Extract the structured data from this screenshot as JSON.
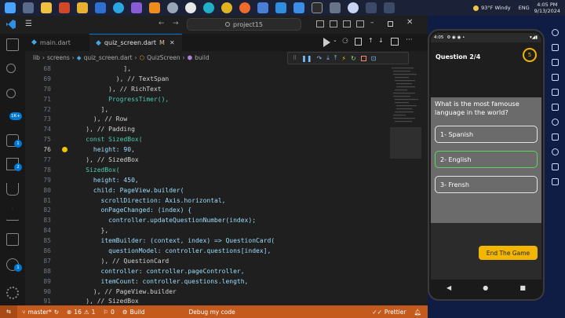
{
  "taskbar": {
    "weather": "93°F  Windy",
    "language": "ENG",
    "time": "4:05 PM",
    "date": "9/13/2024"
  },
  "vscode": {
    "search_placeholder": "project15",
    "tabs": [
      {
        "label": "main.dart",
        "modified": ""
      },
      {
        "label": "quiz_screen.dart",
        "modified": "M"
      }
    ],
    "breadcrumb": [
      "lib",
      "screens",
      "quiz_screen.dart",
      "QuizScreen",
      "build"
    ],
    "line_numbers": [
      "68",
      "69",
      "70",
      "71",
      "72",
      "73",
      "74",
      "75",
      "76",
      "77",
      "78",
      "79",
      "80",
      "81",
      "82",
      "83",
      "84",
      "85",
      "86",
      "87",
      "88",
      "89",
      "90",
      "91",
      "92"
    ],
    "current_line": "76",
    "code_lines": [
      "              ],",
      "            ), // TextSpan",
      "          ), // RichText",
      "          ProgressTimer(),",
      "        ],",
      "      ), // Row",
      "    ), // Padding",
      "    const SizedBox(",
      "      height: 90,",
      "    ), // SizedBox",
      "    SizedBox(",
      "      height: 450,",
      "      child: PageView.builder(",
      "        scrollDirection: Axis.horizontal,",
      "        onPageChanged: (index) {",
      "          controller.updateQuestionNumber(index);",
      "        },",
      "        itemBuilder: (context, index) => QuestionCard(",
      "          questionModel: controller.questions[index],",
      "        ), // QuestionCard",
      "        controller: controller.pageController,",
      "        itemCount: controller.questions.length,",
      "      ), // PageView.builder",
      "    ), // SizedBox",
      "  ]"
    ],
    "status": {
      "branch": "master*",
      "errors": "16",
      "warnings": "1",
      "ports": "0",
      "build": "Build",
      "debug": "Debug my code",
      "prettier": "Prettier"
    },
    "badges": {
      "source_control": "1K+",
      "run": "1",
      "extensions": "2",
      "accounts": "1"
    }
  },
  "phone": {
    "status_time": "4:05",
    "question_label": "Question 2/4",
    "timer_value": "5",
    "question_text": "What is the most famouse language in the world?",
    "options": [
      "1- Spanish",
      "2- English",
      "3- Frensh"
    ],
    "selected_option": "2- English",
    "end_button": "End The Game",
    "nav": {
      "back": "◀",
      "home": "●",
      "recents": "■"
    }
  },
  "colors": {
    "accent_orange": "#f2b600",
    "status_bar": "#c45a1c",
    "selected_green": "#5cd65c"
  }
}
